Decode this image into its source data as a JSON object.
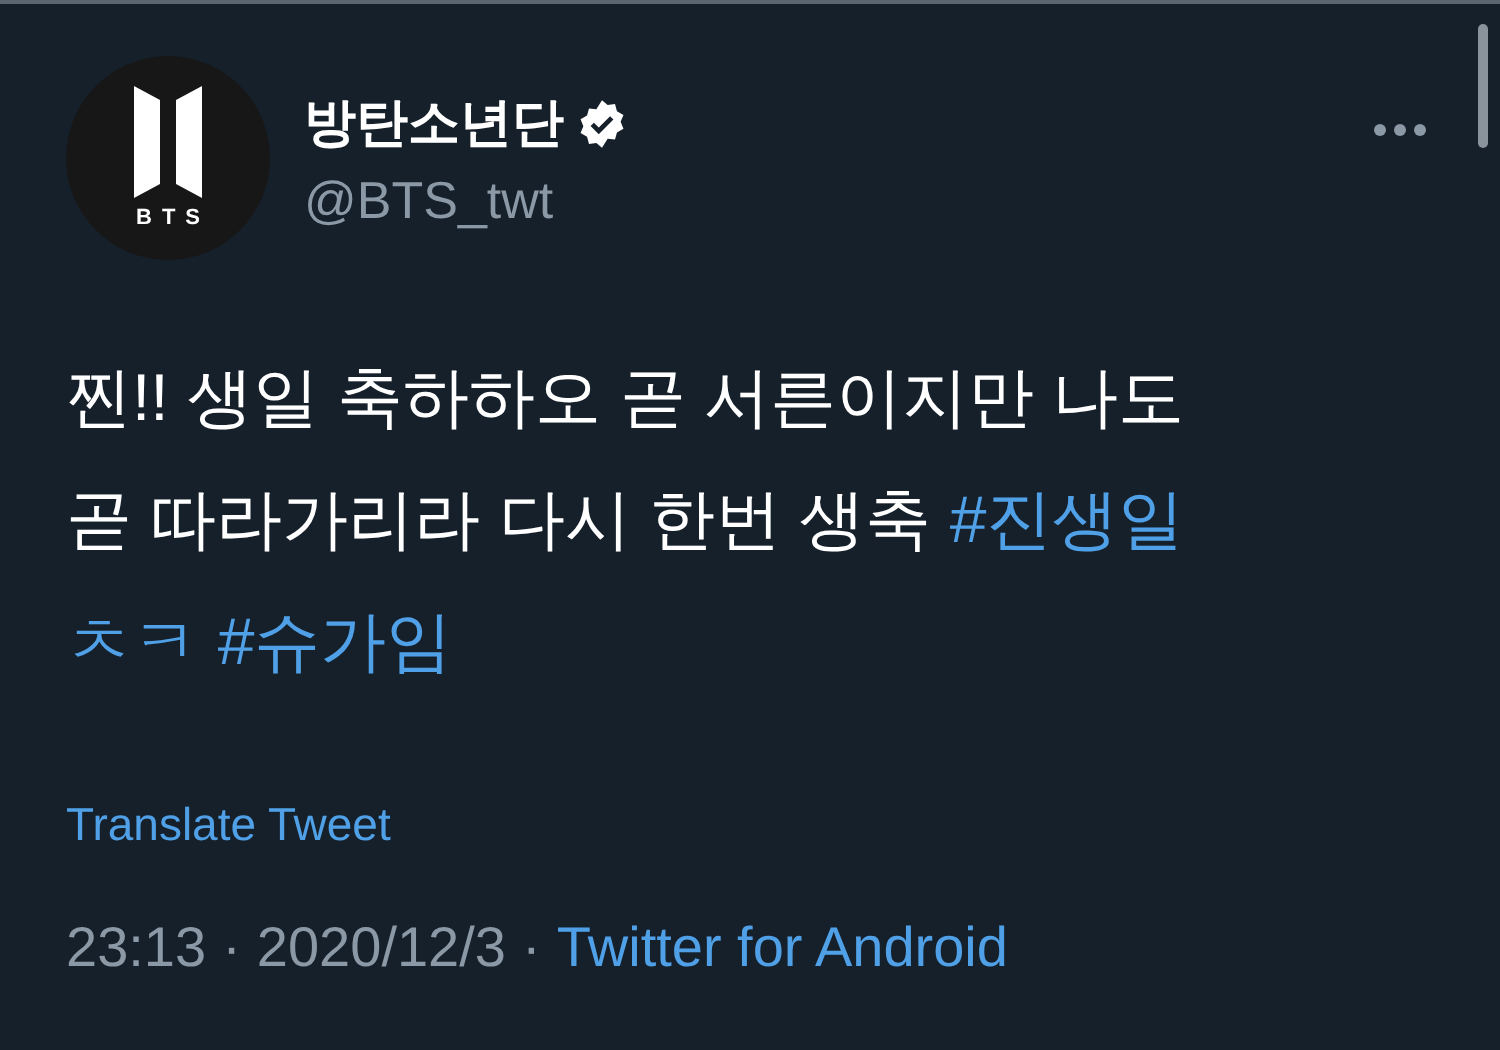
{
  "author": {
    "avatar_text": "BTS",
    "name": "방탄소년단",
    "verified": true,
    "handle": "@BTS_twt"
  },
  "body_lines": [
    [
      {
        "kind": "text",
        "text": "찐!! 생일 축하하오 곧 서른이지만 나도"
      }
    ],
    [
      {
        "kind": "text",
        "text": "곧 따라가리라 다시 한번 생축 "
      },
      {
        "kind": "link",
        "text": "#진생일"
      }
    ],
    [
      {
        "kind": "link",
        "text": "ㅊㅋ"
      },
      {
        "kind": "link",
        "text": "#슈가임"
      }
    ]
  ],
  "translate": "Translate Tweet",
  "meta": {
    "time": "23:13",
    "date": "2020/12/3",
    "separator": "·",
    "source": "Twitter for Android"
  }
}
